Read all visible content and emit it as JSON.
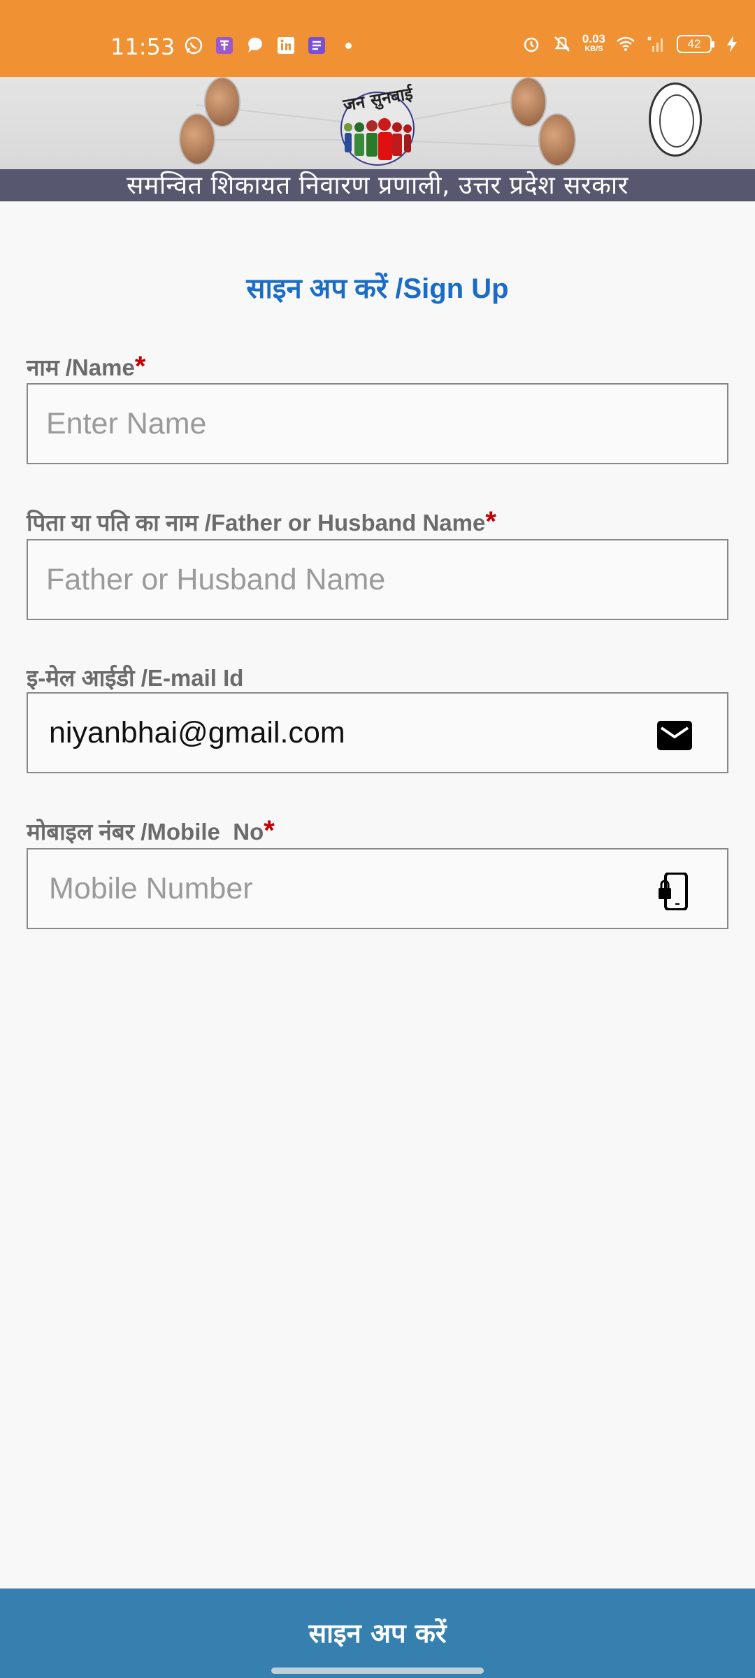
{
  "status_bar": {
    "time": "11:53",
    "net_speed_value": "0.03",
    "net_speed_unit": "KB/S",
    "battery": "42",
    "icons_left": [
      "whatsapp-icon",
      "app-icon",
      "chat-bubble-icon",
      "linkedin-icon",
      "notes-icon"
    ],
    "icons_right": [
      "alarm-icon",
      "mute-icon",
      "wifi-icon",
      "signal-icon",
      "charging-icon"
    ]
  },
  "banner": {
    "logo_text": "जन सुनवाई",
    "subtitle": "समन्वित शिकायत निवारण प्रणाली, उत्तर प्रदेश सरकार"
  },
  "form": {
    "title": "साइन अप करें /Sign Up",
    "required_marker": "*",
    "name": {
      "label": "नाम /Name",
      "placeholder": "Enter Name",
      "value": ""
    },
    "father_name": {
      "label": "पिता या पति का नाम /Father or Husband Name",
      "placeholder": "Father or Husband Name",
      "value": ""
    },
    "email": {
      "label": "इ-मेल आईडी /E-mail Id",
      "placeholder": "",
      "value": "niyanbhai@gmail.com",
      "icon": "mail-icon"
    },
    "mobile": {
      "label": "मोबाइल नंबर /Mobile  No",
      "placeholder": "Mobile Number",
      "value": "",
      "icon": "mobile-lock-icon"
    }
  },
  "submit_button": {
    "label": "साइन अप करें"
  },
  "colors": {
    "status_bar": "#f09234",
    "title": "#1a6cc7",
    "required": "#c00000",
    "button": "#3580ae"
  }
}
